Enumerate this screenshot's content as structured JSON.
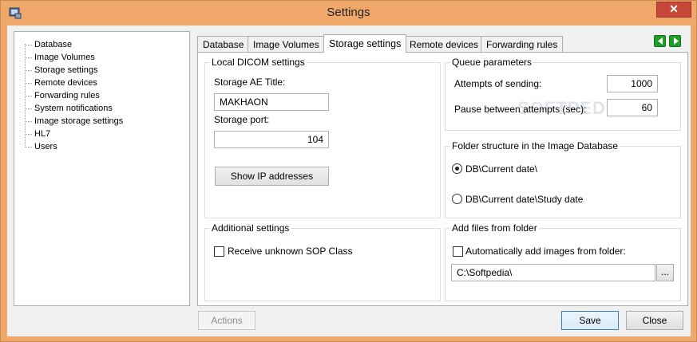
{
  "window": {
    "title": "Settings",
    "close_label": "✕"
  },
  "sidebar": {
    "items": [
      {
        "label": "Database"
      },
      {
        "label": "Image Volumes"
      },
      {
        "label": "Storage settings"
      },
      {
        "label": "Remote devices"
      },
      {
        "label": "Forwarding rules"
      },
      {
        "label": "System notifications"
      },
      {
        "label": "Image storage settings"
      },
      {
        "label": "HL7"
      },
      {
        "label": "Users"
      }
    ]
  },
  "tabs": [
    {
      "label": "Database"
    },
    {
      "label": "Image Volumes"
    },
    {
      "label": "Storage settings",
      "active": true
    },
    {
      "label": "Remote devices"
    },
    {
      "label": "Forwarding rules"
    }
  ],
  "local_dicom": {
    "title": "Local DICOM settings",
    "ae_title_label": "Storage AE Title:",
    "ae_title_value": "MAKHAON",
    "port_label": "Storage port:",
    "port_value": "104",
    "show_ip_button": "Show IP addresses"
  },
  "queue": {
    "title": "Queue parameters",
    "attempts_label": "Attempts of sending:",
    "attempts_value": "1000",
    "pause_label": "Pause between attempts (sec):",
    "pause_value": "60"
  },
  "folder_structure": {
    "title": "Folder structure in the Image Database",
    "option1": "DB\\Current date\\",
    "option2": "DB\\Current date\\Study date",
    "selected": "option1"
  },
  "additional": {
    "title": "Additional settings",
    "receive_unknown_label": "Receive unknown SOP Class",
    "receive_unknown_checked": false
  },
  "add_files": {
    "title": "Add files from folder",
    "auto_add_label": "Automatically add images from folder:",
    "auto_add_checked": false,
    "folder_value": "C:\\Softpedia\\",
    "browse_label": "..."
  },
  "footer": {
    "actions_label": "Actions",
    "save_label": "Save",
    "close_label": "Close"
  },
  "watermark": "SOFTPEDIA",
  "colors": {
    "window_frame": "#f0a86a",
    "nav_arrow": "#1f9e2a",
    "close_button": "#c7473a"
  }
}
